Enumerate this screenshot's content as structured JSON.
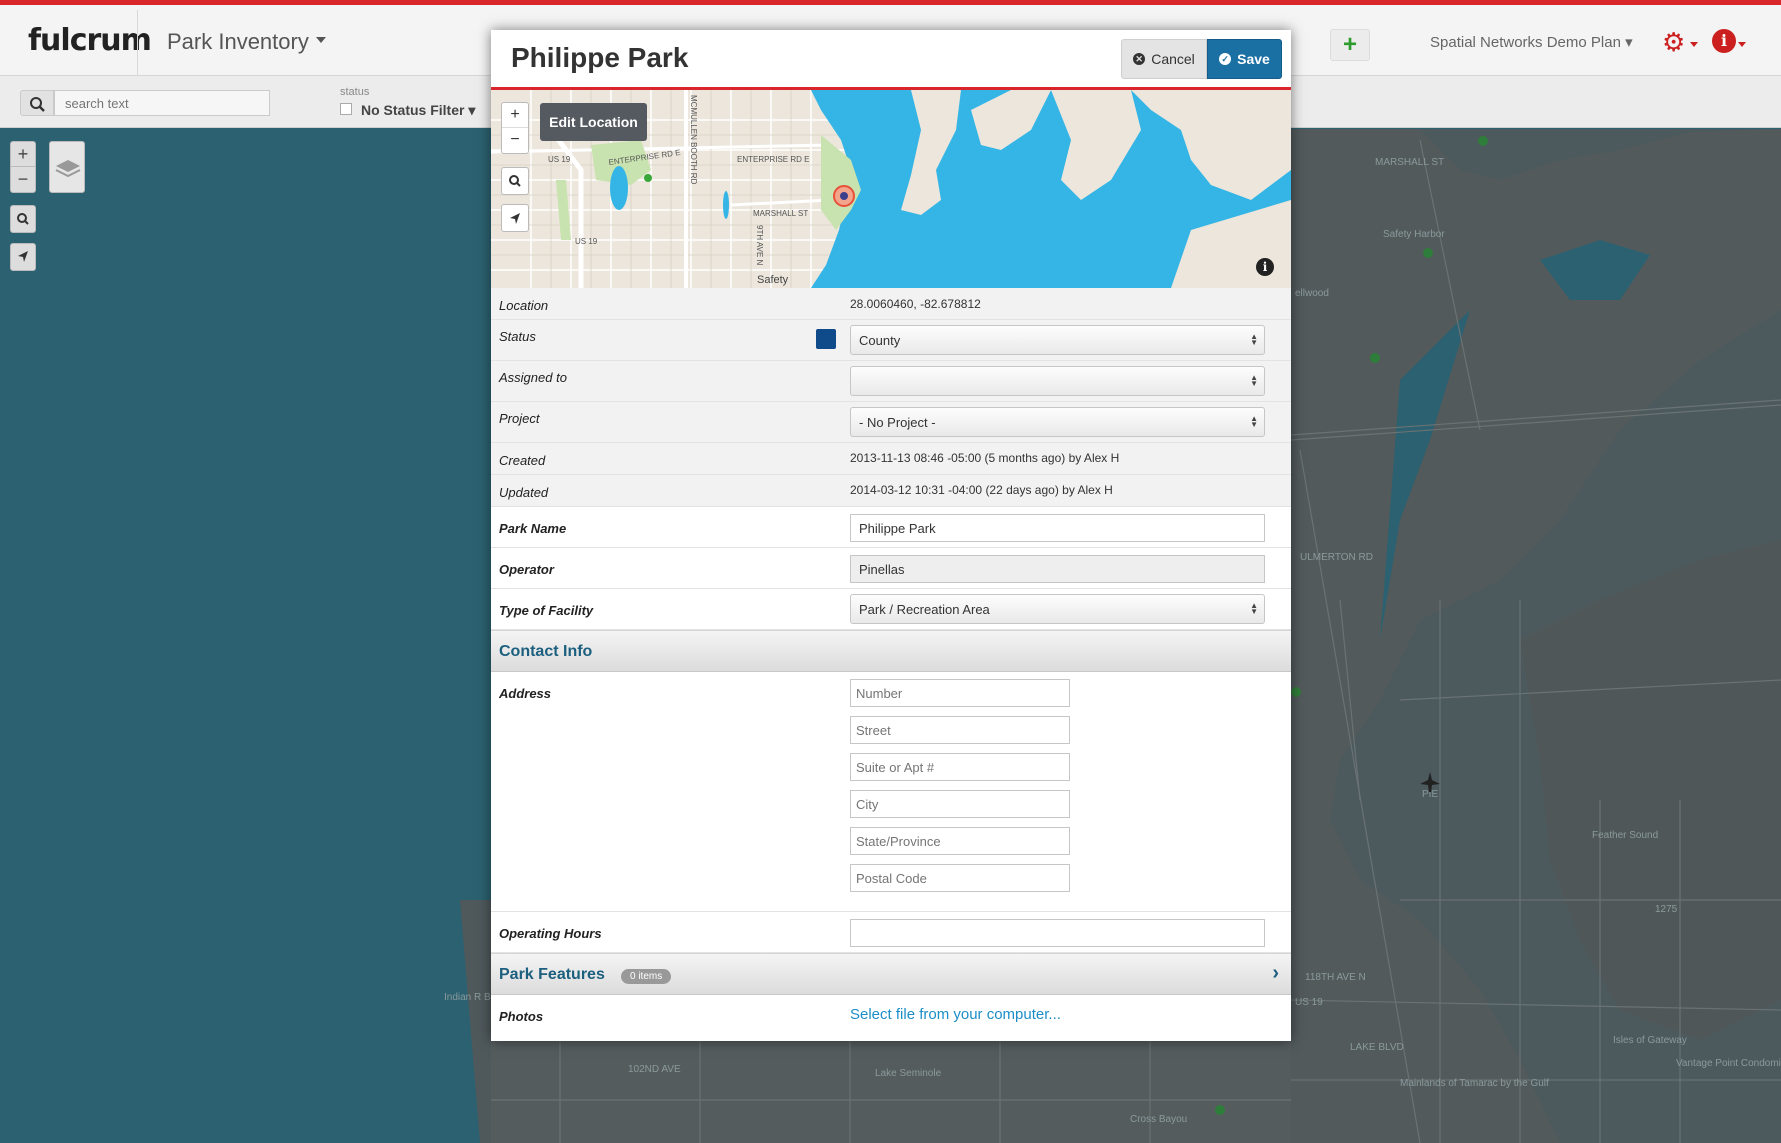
{
  "app": {
    "logo": "fulcrum",
    "title": "Park Inventory",
    "plan": "Spatial Networks Demo Plan",
    "add_label": "+",
    "icons": [
      "gear-icon",
      "info-icon",
      "search-icon",
      "layers-icon",
      "locate-icon"
    ]
  },
  "filter": {
    "search_placeholder": "search text",
    "status_label": "status",
    "status_filter": "No Status Filter"
  },
  "map_controls": {
    "zoom_in": "+",
    "zoom_out": "−"
  },
  "modal": {
    "title": "Philippe Park",
    "cancel_label": "Cancel",
    "save_label": "Save",
    "edit_location_label": "Edit Location",
    "info_glyph": "i",
    "map_labels": [
      "ENTERPRISE RD E",
      "ENTERPRISE RD E",
      "MARSHALL ST",
      "US 19",
      "US 19",
      "MCMULLEN BOOTH RD",
      "9TH AVE N",
      "Safety"
    ],
    "fields": {
      "location": {
        "label": "Location",
        "value": "28.0060460, -82.678812"
      },
      "status": {
        "label": "Status",
        "value": "County",
        "color": "#0f4a8a"
      },
      "assigned_to": {
        "label": "Assigned to",
        "value": ""
      },
      "project": {
        "label": "Project",
        "value": "- No Project -"
      },
      "created": {
        "label": "Created",
        "value": "2013-11-13 08:46 -05:00 (5 months ago) by Alex H"
      },
      "updated": {
        "label": "Updated",
        "value": "2014-03-12 10:31 -04:00 (22 days ago) by Alex H"
      },
      "park_name": {
        "label": "Park Name",
        "value": "Philippe Park"
      },
      "operator": {
        "label": "Operator",
        "value": "Pinellas"
      },
      "facility_type": {
        "label": "Type of Facility",
        "value": "Park / Recreation Area"
      }
    },
    "contact_section": "Contact Info",
    "address": {
      "label": "Address",
      "number_placeholder": "Number",
      "street_placeholder": "Street",
      "suite_placeholder": "Suite or Apt #",
      "city_placeholder": "City",
      "state_placeholder": "State/Province",
      "postal_placeholder": "Postal Code"
    },
    "operating_hours": {
      "label": "Operating Hours",
      "value": ""
    },
    "park_features": {
      "title": "Park Features",
      "badge": "0 items"
    },
    "photos": {
      "label": "Photos",
      "link": "Select file from your computer..."
    }
  },
  "bg_map_labels": [
    "MARSHALL ST",
    "Safety Harbor",
    "ellwood",
    "PIE",
    "Feather Sound",
    "Indian R Beach",
    "Isles of Gateway",
    "Vantage Point Condominium",
    "Lake Seminole",
    "Cross Bayou",
    "Mainlands of Tamarac by the Gulf",
    "ULMERTON RD",
    "LAKE BLVD",
    "118TH AVE N",
    "102ND AVE",
    "1275",
    "US 19"
  ],
  "colors": {
    "accent_red": "#d9262a",
    "save_blue": "#1a6fa3",
    "water": "#35b5e5",
    "section_title": "#1c5f7e"
  }
}
